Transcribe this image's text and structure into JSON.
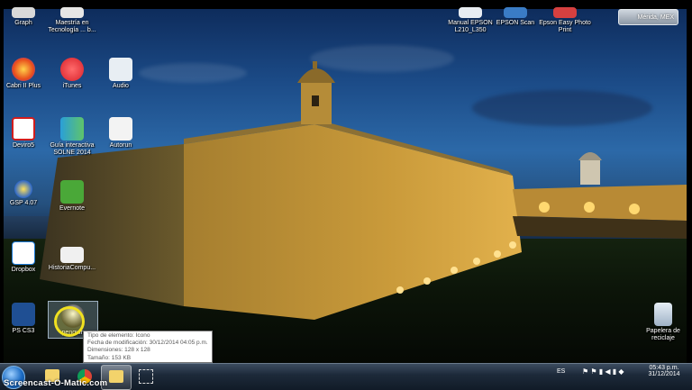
{
  "desktop": {
    "icons": [
      {
        "label": "Graph"
      },
      {
        "label": "Maestría en Tecnología ... b..."
      },
      {
        "label": "Cabri II Plus"
      },
      {
        "label": "iTunes"
      },
      {
        "label": "Audio"
      },
      {
        "label": "Deviro5"
      },
      {
        "label": "Guía interactiva SOLNE 2014"
      },
      {
        "label": "Autorun"
      },
      {
        "label": "GSP 4.07"
      },
      {
        "label": "Evernote"
      },
      {
        "label": "Dropbox"
      },
      {
        "label": "HistoriaCompu..."
      },
      {
        "label": "PS CS3"
      },
      {
        "label": "penguin"
      },
      {
        "label": "Manual EPSON L210_L350"
      },
      {
        "label": "EPSON Scan"
      },
      {
        "label": "Epson Easy Photo Print"
      },
      {
        "label": "Papelera de reciclaje"
      }
    ]
  },
  "weather_gadget": {
    "text": "Mérida, MEX"
  },
  "tooltip": {
    "line1": "Tipo de elemento: Icono",
    "line2": "Fecha de modificación: 30/12/2014 04:05 p.m.",
    "line3": "Dimensiones: 128 x 128",
    "line4": "Tamaño: 153 KB"
  },
  "taskbar": {
    "language": "ES",
    "time": "05:43 p.m.",
    "date": "31/12/2014"
  },
  "watermark": "Screencast-O-Matic.com",
  "colors": {
    "taskbar": "#1d2a3a",
    "cursor_highlight": "#f0e020",
    "fort_light": "#c99a3a"
  }
}
